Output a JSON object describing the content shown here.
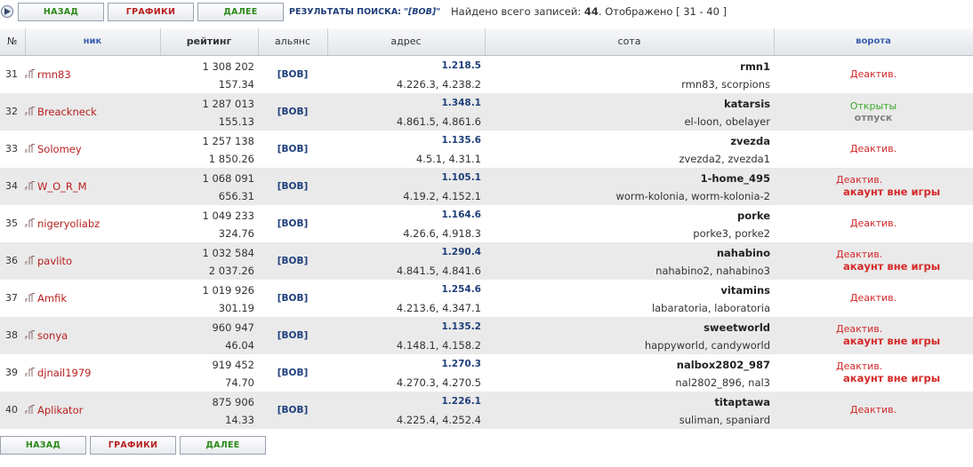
{
  "toolbar": {
    "back_label": "НАЗАД",
    "charts_label": "ГРАФИКИ",
    "next_label": "ДАЛЕЕ",
    "search_label": "РЕЗУЛЬТАТЫ ПОИСКА:",
    "search_query": "\"[BOB]\"",
    "found_prefix": "Найдено всего записей:",
    "found_count": "44",
    "shown_text": ". Отображено [ 31 - 40 ]"
  },
  "table": {
    "headers": {
      "num": "№",
      "nick": "ник",
      "rating": "рейтинг",
      "alliance": "альянс",
      "address": "адрес",
      "sota": "сота",
      "gate": "ворота"
    },
    "rows": [
      {
        "num": "31",
        "nick": "rmn83",
        "rating": "1 308 202",
        "rating2": "157.34",
        "alliance": "[BOB]",
        "addr_main": "1.218.5",
        "addr_other": "4.226.3, 4.238.2",
        "sota_main": "rmn1",
        "sota_other": "rmn83, scorpions",
        "gate": "Деактив."
      },
      {
        "num": "32",
        "nick": "Breackneck",
        "rating": "1 287 013",
        "rating2": "155.13",
        "alliance": "[BOB]",
        "addr_main": "1.348.1",
        "addr_other": "4.861.5, 4.861.6",
        "sota_main": "katarsis",
        "sota_other": "el-loon, obelayer",
        "gate_open": "Открыты",
        "gate_vacation": "отпуск"
      },
      {
        "num": "33",
        "nick": "Solomey",
        "rating": "1 257 138",
        "rating2": "1 850.26",
        "alliance": "[BOB]",
        "addr_main": "1.135.6",
        "addr_other": "4.5.1, 4.31.1",
        "sota_main": "zvezda",
        "sota_other": "zvezda2, zvezda1",
        "gate": "Деактив."
      },
      {
        "num": "34",
        "nick": "W_O_R_M",
        "rating": "1 068 091",
        "rating2": "656.31",
        "alliance": "[BOB]",
        "addr_main": "1.105.1",
        "addr_other": "4.19.2, 4.152.1",
        "sota_main": "1-home_495",
        "sota_other": "worm-kolonia, worm-kolonia-2",
        "gate": "Деактив.",
        "gate_note": "акаунт вне игры"
      },
      {
        "num": "35",
        "nick": "nigeryoliabz",
        "rating": "1 049 233",
        "rating2": "324.76",
        "alliance": "[BOB]",
        "addr_main": "1.164.6",
        "addr_other": "4.26.6, 4.918.3",
        "sota_main": "porke",
        "sota_other": "porke3, porke2",
        "gate": "Деактив."
      },
      {
        "num": "36",
        "nick": "pavlito",
        "rating": "1 032 584",
        "rating2": "2 037.26",
        "alliance": "[BOB]",
        "addr_main": "1.290.4",
        "addr_other": "4.841.5, 4.841.6",
        "sota_main": "nahabino",
        "sota_other": "nahabino2, nahabino3",
        "gate": "Деактив.",
        "gate_note": "акаунт вне игры"
      },
      {
        "num": "37",
        "nick": "Amfik",
        "rating": "1 019 926",
        "rating2": "301.19",
        "alliance": "[BOB]",
        "addr_main": "1.254.6",
        "addr_other": "4.213.6, 4.347.1",
        "sota_main": "vitamins",
        "sota_other": "labaratoria, laboratoria",
        "gate": "Деактив."
      },
      {
        "num": "38",
        "nick": "sonya",
        "rating": "960 947",
        "rating2": "46.04",
        "alliance": "[BOB]",
        "addr_main": "1.135.2",
        "addr_other": "4.148.1, 4.158.2",
        "sota_main": "sweetworld",
        "sota_other": "happyworld, candyworld",
        "gate": "Деактив.",
        "gate_note": "акаунт вне игры"
      },
      {
        "num": "39",
        "nick": "djnail1979",
        "rating": "919 452",
        "rating2": "74.70",
        "alliance": "[BOB]",
        "addr_main": "1.270.3",
        "addr_other": "4.270.3, 4.270.5",
        "sota_main": "nalbox2802_987",
        "sota_other": "nal2802_896, nal3",
        "gate": "Деактив.",
        "gate_note": "акаунт вне игры"
      },
      {
        "num": "40",
        "nick": "Aplikator",
        "rating": "875 906",
        "rating2": "14.33",
        "alliance": "[BOB]",
        "addr_main": "1.226.1",
        "addr_other": "4.225.4, 4.252.4",
        "sota_main": "titaptawa",
        "sota_other": "suliman, spaniard",
        "gate": "Деактив."
      }
    ]
  },
  "icons": {
    "play": "play-circle-icon",
    "player": "player-flag-icon"
  },
  "colors": {
    "nick": "#b81f1f",
    "alliance": "#1f3f7a",
    "deactivated": "#d42a2a",
    "open": "#3aaa2a",
    "green_button": "#2b8a1a",
    "red_button": "#b81f1f"
  }
}
